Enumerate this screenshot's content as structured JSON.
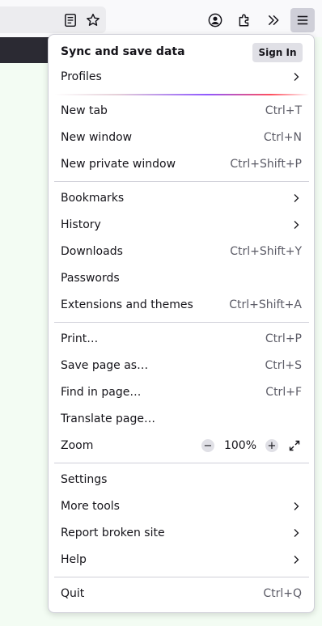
{
  "toolbar": {
    "icons": [
      "reader-view-icon",
      "bookmark-star-icon",
      "account-icon",
      "extensions-icon",
      "overflow-chevrons-icon",
      "hamburger-menu-icon"
    ]
  },
  "menu": {
    "sync": {
      "title": "Sync and save data",
      "sign_in": "Sign In"
    },
    "profiles": {
      "label": "Profiles"
    },
    "new_tab": {
      "label": "New tab",
      "shortcut": "Ctrl+T"
    },
    "new_window": {
      "label": "New window",
      "shortcut": "Ctrl+N"
    },
    "new_private_window": {
      "label": "New private window",
      "shortcut": "Ctrl+Shift+P"
    },
    "bookmarks": {
      "label": "Bookmarks"
    },
    "history": {
      "label": "History"
    },
    "downloads": {
      "label": "Downloads",
      "shortcut": "Ctrl+Shift+Y"
    },
    "passwords": {
      "label": "Passwords"
    },
    "extensions": {
      "label": "Extensions and themes",
      "shortcut": "Ctrl+Shift+A"
    },
    "print": {
      "label": "Print…",
      "shortcut": "Ctrl+P"
    },
    "save_page": {
      "label": "Save page as…",
      "shortcut": "Ctrl+S"
    },
    "find": {
      "label": "Find in page…",
      "shortcut": "Ctrl+F"
    },
    "translate": {
      "label": "Translate page…"
    },
    "zoom": {
      "label": "Zoom",
      "minus": "−",
      "value": "100%",
      "plus": "+"
    },
    "settings": {
      "label": "Settings"
    },
    "more_tools": {
      "label": "More tools"
    },
    "report": {
      "label": "Report broken site"
    },
    "help": {
      "label": "Help"
    },
    "quit": {
      "label": "Quit",
      "shortcut": "Ctrl+Q"
    }
  }
}
